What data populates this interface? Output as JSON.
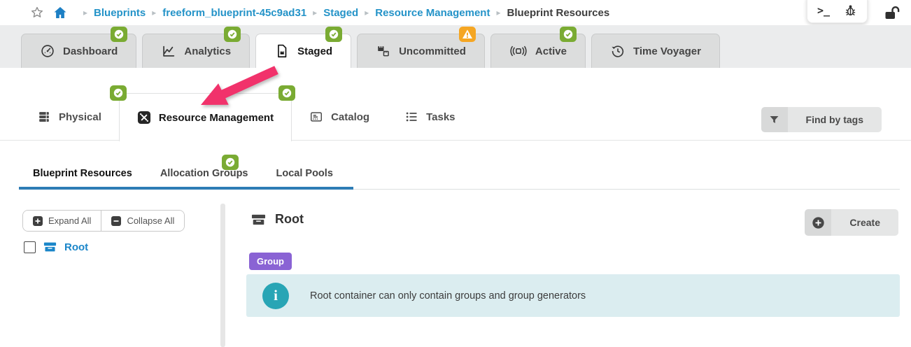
{
  "breadcrumb": {
    "items": [
      "Blueprints",
      "freeform_blueprint-45c9ad31",
      "Staged",
      "Resource Management"
    ],
    "current": "Blueprint Resources"
  },
  "topbar": {
    "icons": [
      "terminal-icon",
      "bug-icon",
      "unlock-icon"
    ],
    "terminal_glyph": ">_"
  },
  "main_tabs": {
    "items": [
      {
        "label": "Dashboard",
        "badge": "check",
        "active": false
      },
      {
        "label": "Analytics",
        "badge": "check",
        "active": false
      },
      {
        "label": "Staged",
        "badge": "check",
        "active": true
      },
      {
        "label": "Uncommitted",
        "badge": "warning",
        "active": false
      },
      {
        "label": "Active",
        "badge": "check",
        "active": false
      },
      {
        "label": "Time Voyager",
        "badge": "none",
        "active": false
      }
    ]
  },
  "sub_tabs": {
    "items": [
      {
        "label": "Physical",
        "active": false
      },
      {
        "label": "Resource Management",
        "active": true,
        "badges": [
          "check",
          "check"
        ]
      },
      {
        "label": "Catalog",
        "active": false
      },
      {
        "label": "Tasks",
        "active": false
      }
    ],
    "find_by_tags": "Find by tags"
  },
  "tertiary_tabs": {
    "items": [
      {
        "label": "Blueprint Resources",
        "active": true
      },
      {
        "label": "Allocation Groups",
        "active": false
      },
      {
        "label": "Local Pools",
        "active": false,
        "badge": "check"
      }
    ]
  },
  "tree_panel": {
    "expand_all": "Expand All",
    "collapse_all": "Collapse All",
    "root_item": "Root"
  },
  "detail": {
    "title": "Root",
    "type_badge": "Group",
    "create_label": "Create",
    "info_message": "Root container can only contain groups and group generators"
  },
  "colors": {
    "link_blue": "#2493c8",
    "badge_green": "#7aab33",
    "badge_orange": "#f5a623",
    "underline_blue": "#2e7cb5",
    "purple": "#8a63d4",
    "teal": "#28a5b5",
    "arrow_pink": "#f1326b"
  }
}
